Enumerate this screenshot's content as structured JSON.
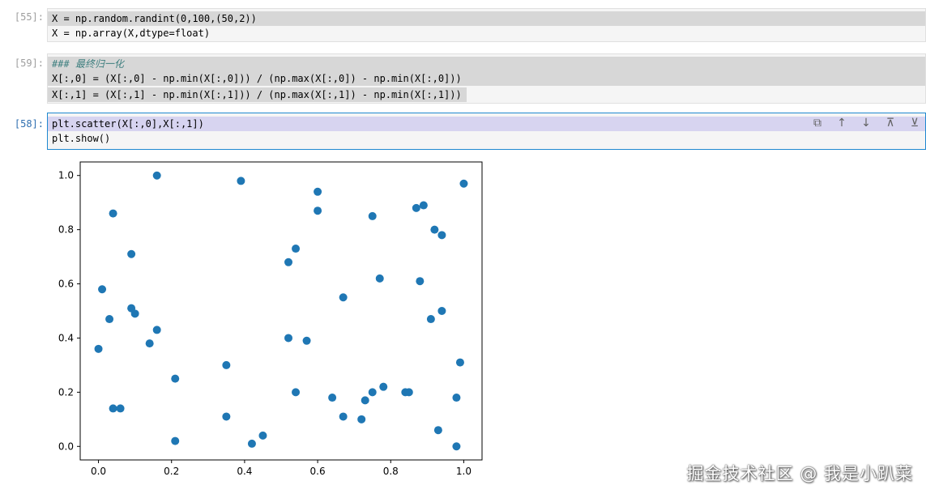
{
  "cells": [
    {
      "prompt": "[55]:",
      "lines": [
        "X = np.random.randint(0,100,(50,2))",
        "X = np.array(X,dtype=float)"
      ]
    },
    {
      "prompt": "[59]:",
      "lines": [
        "### 最终归一化",
        "X[:,0] = (X[:,0] - np.min(X[:,0])) / (np.max(X[:,0]) - np.min(X[:,0]))",
        "X[:,1] = (X[:,1] - np.min(X[:,1])) / (np.max(X[:,1]) - np.min(X[:,1]))"
      ]
    },
    {
      "prompt": "[58]:",
      "lines": [
        "plt.scatter(X[:,0],X[:,1])",
        "plt.show()"
      ]
    }
  ],
  "toolbar": {
    "icons": [
      "duplicate-icon",
      "move-up-icon",
      "move-down-icon",
      "insert-above-icon",
      "insert-below-icon"
    ]
  },
  "watermark": "掘金技术社区 @ 我是小趴菜",
  "colors": {
    "point": "#1f77b4",
    "active_border": "#1f88d0"
  },
  "chart_data": {
    "type": "scatter",
    "xlim": [
      -0.05,
      1.05
    ],
    "ylim": [
      -0.05,
      1.05
    ],
    "xticks": [
      "0.0",
      "0.2",
      "0.4",
      "0.6",
      "0.8",
      "1.0"
    ],
    "yticks": [
      "0.0",
      "0.2",
      "0.4",
      "0.6",
      "0.8",
      "1.0"
    ],
    "grid": false,
    "points": [
      [
        0.0,
        0.36
      ],
      [
        0.01,
        0.58
      ],
      [
        0.03,
        0.47
      ],
      [
        0.04,
        0.14
      ],
      [
        0.04,
        0.86
      ],
      [
        0.06,
        0.14
      ],
      [
        0.09,
        0.71
      ],
      [
        0.09,
        0.51
      ],
      [
        0.1,
        0.49
      ],
      [
        0.14,
        0.38
      ],
      [
        0.16,
        1.0
      ],
      [
        0.16,
        0.43
      ],
      [
        0.21,
        0.25
      ],
      [
        0.21,
        0.02
      ],
      [
        0.35,
        0.3
      ],
      [
        0.35,
        0.11
      ],
      [
        0.39,
        0.98
      ],
      [
        0.42,
        0.01
      ],
      [
        0.45,
        0.04
      ],
      [
        0.52,
        0.4
      ],
      [
        0.52,
        0.68
      ],
      [
        0.54,
        0.73
      ],
      [
        0.54,
        0.2
      ],
      [
        0.57,
        0.39
      ],
      [
        0.6,
        0.94
      ],
      [
        0.6,
        0.87
      ],
      [
        0.64,
        0.18
      ],
      [
        0.67,
        0.55
      ],
      [
        0.67,
        0.11
      ],
      [
        0.72,
        0.1
      ],
      [
        0.73,
        0.17
      ],
      [
        0.75,
        0.85
      ],
      [
        0.75,
        0.2
      ],
      [
        0.77,
        0.62
      ],
      [
        0.78,
        0.22
      ],
      [
        0.84,
        0.2
      ],
      [
        0.85,
        0.2
      ],
      [
        0.87,
        0.88
      ],
      [
        0.88,
        0.61
      ],
      [
        0.89,
        0.89
      ],
      [
        0.91,
        0.47
      ],
      [
        0.92,
        0.8
      ],
      [
        0.93,
        0.06
      ],
      [
        0.94,
        0.78
      ],
      [
        0.94,
        0.5
      ],
      [
        0.98,
        0.0
      ],
      [
        0.98,
        0.18
      ],
      [
        0.99,
        0.31
      ],
      [
        1.0,
        0.97
      ]
    ]
  }
}
